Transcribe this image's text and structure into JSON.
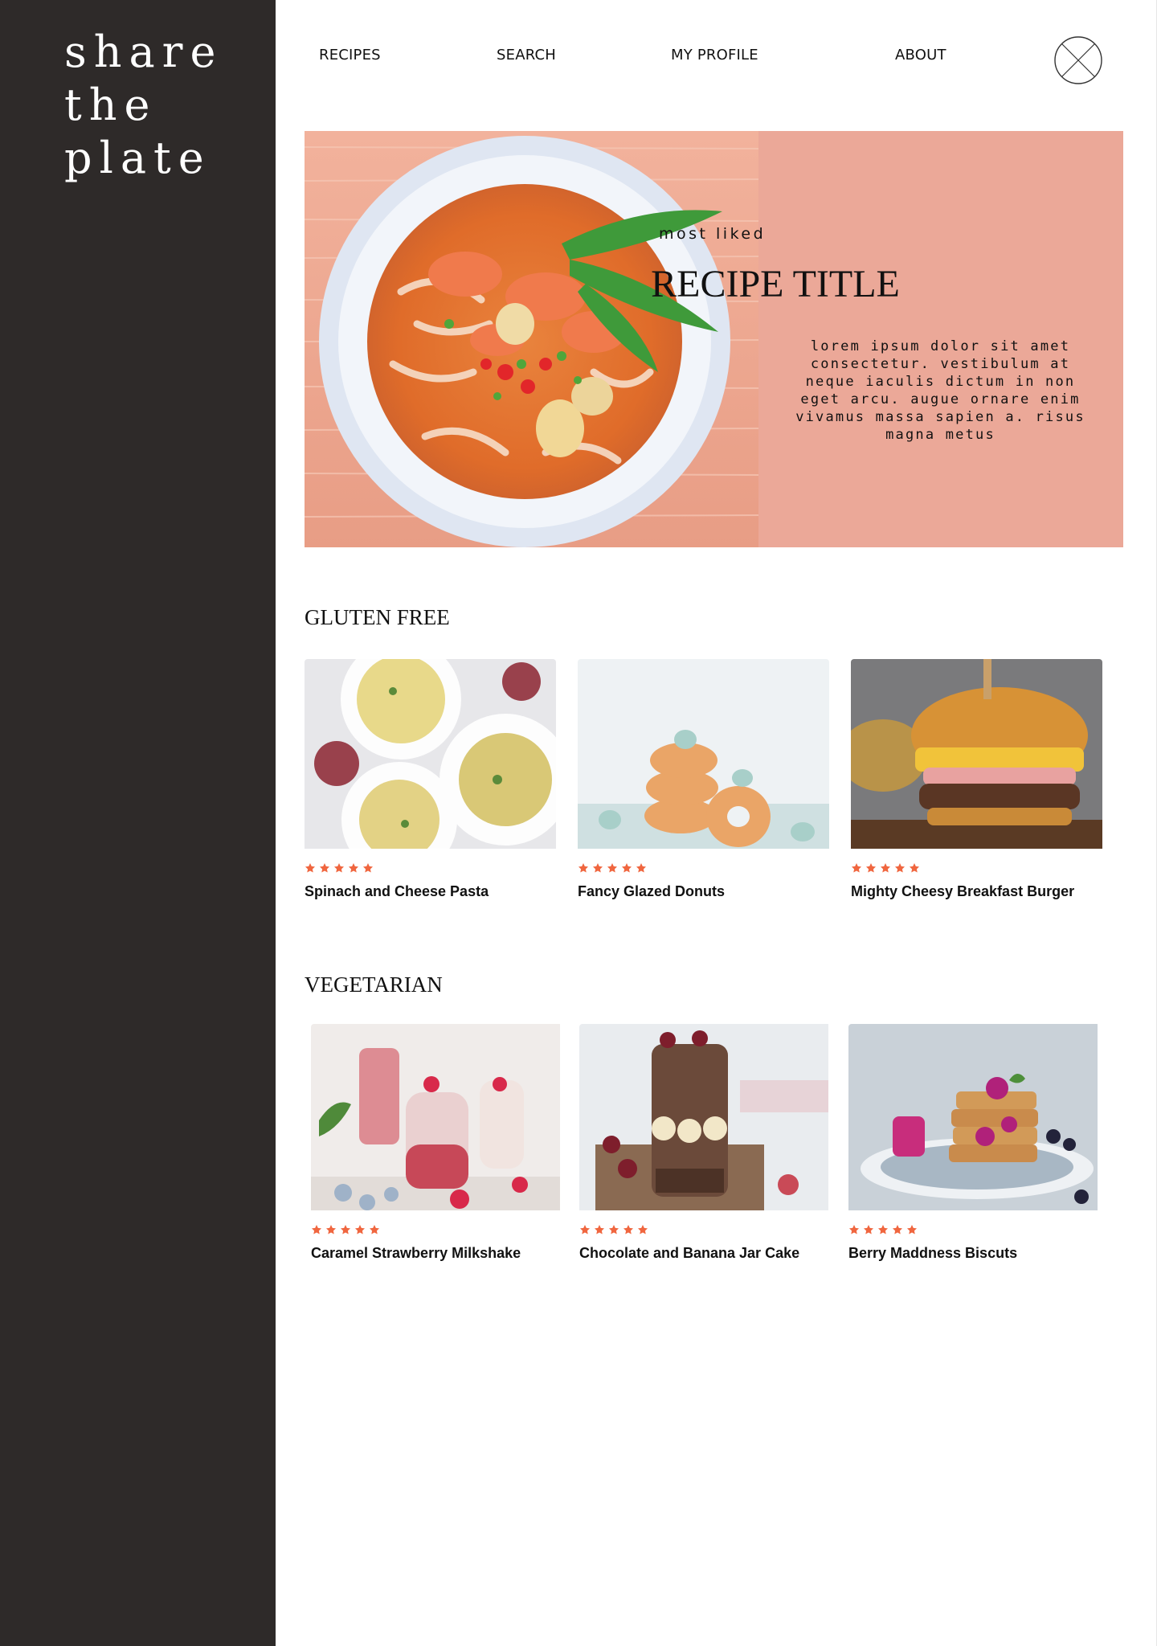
{
  "brand": {
    "lines": [
      "share",
      "the",
      "plate"
    ],
    "sidebar_color": "#2e2a29"
  },
  "nav": {
    "items": [
      "RECIPES",
      "SEARCH",
      "MY PROFILE",
      "ABOUT"
    ],
    "avatar_icon": "avatar-placeholder-icon"
  },
  "hero": {
    "kicker": "most liked",
    "title": "RECIPE TITLE",
    "description": "lorem ipsum dolor sit amet consectetur. vestibulum at neque iaculis dictum in non eget arcu. augue ornare enim vivamus massa sapien a. risus magna metus",
    "panel_color": "#eba898",
    "image": "noodle-soup-photo"
  },
  "sections": [
    {
      "title": "GLUTEN FREE",
      "cards": [
        {
          "title": "Spinach and Cheese Pasta",
          "rating": 5,
          "image": "pasta-photo"
        },
        {
          "title": "Fancy Glazed Donuts",
          "rating": 5,
          "image": "donuts-photo"
        },
        {
          "title": "Mighty Cheesy Breakfast Burger",
          "rating": 5,
          "image": "burger-photo"
        }
      ]
    },
    {
      "title": "VEGETARIAN",
      "cards": [
        {
          "title": "Caramel Strawberry Milkshake",
          "rating": 5,
          "image": "milkshake-photo"
        },
        {
          "title": "Chocolate and Banana Jar Cake",
          "rating": 5,
          "image": "jar-cake-photo"
        },
        {
          "title": "Berry Maddness Biscuts",
          "rating": 5,
          "image": "biscuits-photo"
        }
      ]
    }
  ],
  "colors": {
    "star": "#f0663f",
    "accent": "#eba898"
  }
}
